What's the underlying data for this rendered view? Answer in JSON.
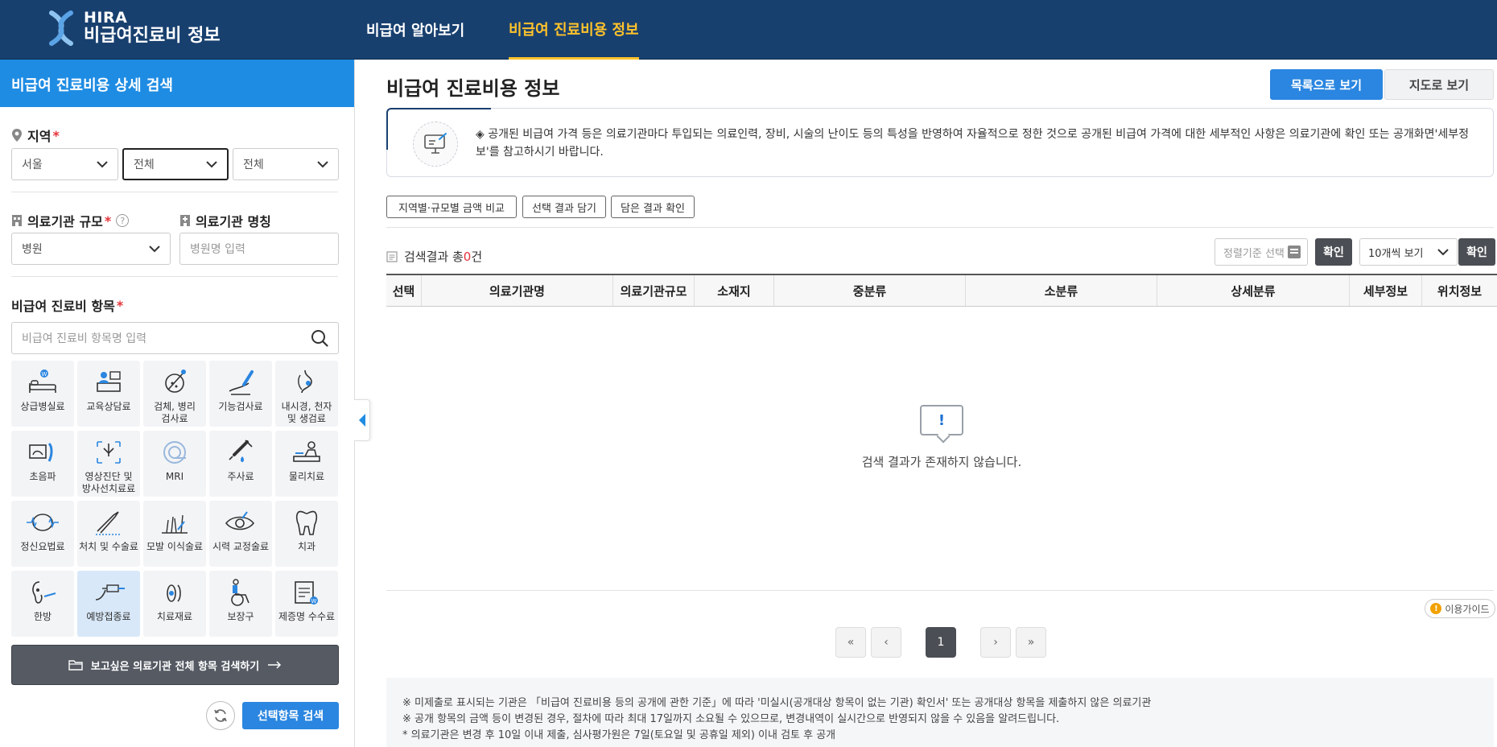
{
  "brand": {
    "line1": "HIRA",
    "line2": "비급여진료비 정보"
  },
  "nav": {
    "items": [
      {
        "label": "비급여 알아보기"
      },
      {
        "label": "비급여 진료비용 정보"
      }
    ],
    "active_index": 1
  },
  "sidebar": {
    "title": "비급여 진료비용 상세 검색",
    "region": {
      "label": "지역",
      "required_mark": "*",
      "selects": [
        "서울",
        "전체",
        "전체"
      ]
    },
    "scale": {
      "label": "의료기관 규모",
      "required_mark": "*",
      "help": "?",
      "value": "병원"
    },
    "name": {
      "label": "의료기관 명칭",
      "placeholder": "병원명 입력"
    },
    "items": {
      "label": "비급여 진료비 항목",
      "required_mark": "*",
      "search_placeholder": "비급여 진료비 항목명 입력"
    },
    "categories": [
      {
        "label": "상급병실료",
        "icon": "bed-icon"
      },
      {
        "label": "교육상담료",
        "icon": "counseling-icon"
      },
      {
        "label": "검체, 병리\n검사료",
        "icon": "specimen-icon"
      },
      {
        "label": "기능검사료",
        "icon": "function-test-icon"
      },
      {
        "label": "내시경, 천자\n및 생검료",
        "icon": "endoscope-icon"
      },
      {
        "label": "초음파",
        "icon": "ultrasound-icon"
      },
      {
        "label": "영상진단 및\n방사선치료료",
        "icon": "radiology-icon"
      },
      {
        "label": "MRI",
        "icon": "mri-icon"
      },
      {
        "label": "주사료",
        "icon": "syringe-icon"
      },
      {
        "label": "물리치료",
        "icon": "physio-icon"
      },
      {
        "label": "정신요법료",
        "icon": "brain-icon"
      },
      {
        "label": "처치 및 수술료",
        "icon": "scalpel-icon"
      },
      {
        "label": "모발 이식술료",
        "icon": "hair-icon"
      },
      {
        "label": "시력 교정술료",
        "icon": "eye-icon"
      },
      {
        "label": "치과",
        "icon": "tooth-icon"
      },
      {
        "label": "한방",
        "icon": "acupuncture-icon"
      },
      {
        "label": "예방접종료",
        "icon": "vaccine-icon"
      },
      {
        "label": "치료재료",
        "icon": "material-icon"
      },
      {
        "label": "보장구",
        "icon": "wheelchair-icon"
      },
      {
        "label": "제증명 수수료",
        "icon": "certificate-icon"
      }
    ],
    "selected_category": 16,
    "all_search": "보고싶은 의료기관 전체 항목 검색하기",
    "search_btn": "선택항목 검색"
  },
  "main": {
    "title": "비급여 진료비용 정보",
    "view_list": "목록으로 보기",
    "view_map": "지도로 보기",
    "notice": "◈ 공개된 비급여 가격 등은 의료기관마다 투입되는 의료인력, 장비, 시술의 난이도 등의 특성을 반영하여 자율적으로 정한 것으로 공개된 비급여 가격에 대한 세부적인 사항은 의료기관에 확인 또는 공개화면'세부정보'를 참고하시기 바랍니다.",
    "tools": [
      "지역별·규모별 금액 비교",
      "선택 결과 담기",
      "담은 결과 확인"
    ],
    "result_prefix": "검색결과 총",
    "result_count": "0",
    "result_suffix": "건",
    "sort_placeholder": "정렬기준 선택",
    "confirm": "확인",
    "per_page": "10개씩 보기",
    "columns": [
      "선택",
      "의료기관명",
      "의료기관규모",
      "소재지",
      "중분류",
      "소분류",
      "상세분류",
      "세부정보",
      "위치정보"
    ],
    "empty_mark": "!",
    "empty_message": "검색 결과가 존재하지 않습니다.",
    "guide": "이용가이드",
    "guide_mark": "!",
    "pagination": {
      "first": "«",
      "prev": "‹",
      "current": "1",
      "next": "›",
      "last": "»"
    },
    "footnotes": [
      "※ 미제출로 표시되는 기관은 「비급여 진료비용 등의 공개에 관한 기준」에 따라 '미실시(공개대상 항목이 없는 기관) 확인서' 또는 공개대상 항목을 제출하지 않은 의료기관",
      "※ 공개 항목의 금액 등이 변경된 경우, 절차에 따라 최대 17일까지 소요될 수 있으므로, 변경내역이 실시간으로 반영되지 않을 수 있음을 알려드립니다.",
      "* 의료기관은 변경 후 10일 이내 제출, 심사평가원은 7일(토요일 및 공휴일 제외) 이내 검토 후 공개"
    ]
  },
  "colors": {
    "header": "#18406f",
    "accent": "#1f8ce3",
    "active_nav": "#ffc32b",
    "required": "#e5333a"
  }
}
